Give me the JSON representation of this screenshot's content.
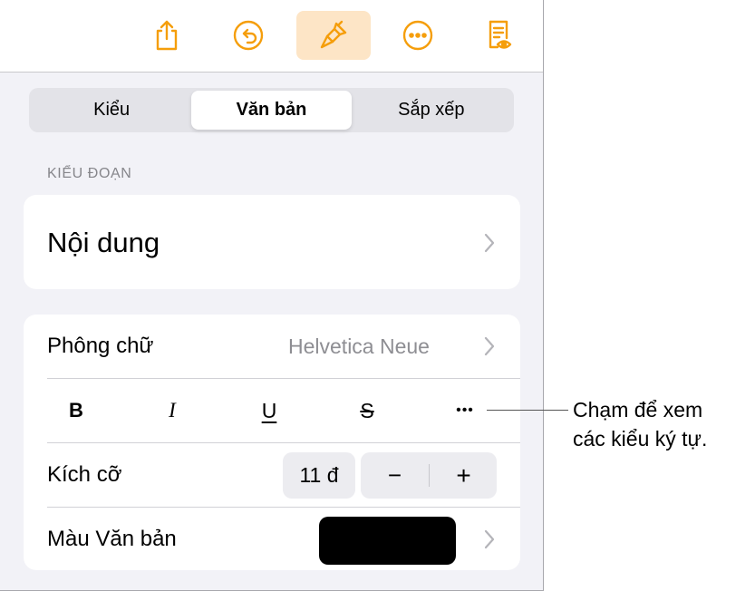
{
  "toolbar": {
    "buttons": [
      {
        "name": "share",
        "icon": "share-icon"
      },
      {
        "name": "undo",
        "icon": "undo-icon"
      },
      {
        "name": "format",
        "icon": "paintbrush-icon",
        "active": true
      },
      {
        "name": "more",
        "icon": "more-icon"
      },
      {
        "name": "reading-view",
        "icon": "document-eye-icon"
      }
    ]
  },
  "tabs": [
    {
      "label": "Kiểu",
      "selected": false
    },
    {
      "label": "Văn bản",
      "selected": true
    },
    {
      "label": "Sắp xếp",
      "selected": false
    }
  ],
  "paragraph_style": {
    "header": "KIỂU ĐOẠN",
    "value": "Nội dung"
  },
  "font": {
    "label": "Phông chữ",
    "value": "Helvetica Neue"
  },
  "format_buttons": {
    "bold": "B",
    "italic": "I",
    "underline": "U",
    "strikethrough": "S",
    "more": "•••"
  },
  "size": {
    "label": "Kích cỡ",
    "value": "11 đ",
    "decrease": "−",
    "increase": "+"
  },
  "text_color": {
    "label": "Màu Văn bản",
    "color": "#000000"
  },
  "callout": {
    "line1": "Chạm để xem",
    "line2": "các kiểu ký tự."
  },
  "colors": {
    "accent": "#f59e0b",
    "active_bg": "#fde5c6"
  }
}
